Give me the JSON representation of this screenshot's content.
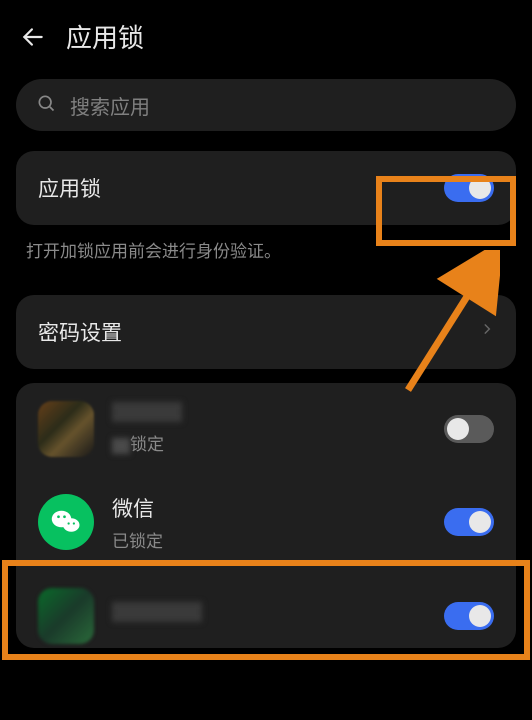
{
  "header": {
    "title": "应用锁"
  },
  "search": {
    "placeholder": "搜索应用"
  },
  "master_toggle": {
    "label": "应用锁",
    "on": true
  },
  "helper_text": "打开加锁应用前会进行身份验证。",
  "password_row": {
    "label": "密码设置"
  },
  "apps": [
    {
      "name": "",
      "sub": "锁定",
      "locked": false,
      "blurred": true
    },
    {
      "name": "微信",
      "sub": "已锁定",
      "locked": true,
      "blurred": false
    },
    {
      "name": "",
      "sub": "",
      "locked": true,
      "blurred": true
    }
  ],
  "annotations": {
    "highlight_master_toggle": true,
    "highlight_wechat_row": true,
    "arrow": true
  }
}
